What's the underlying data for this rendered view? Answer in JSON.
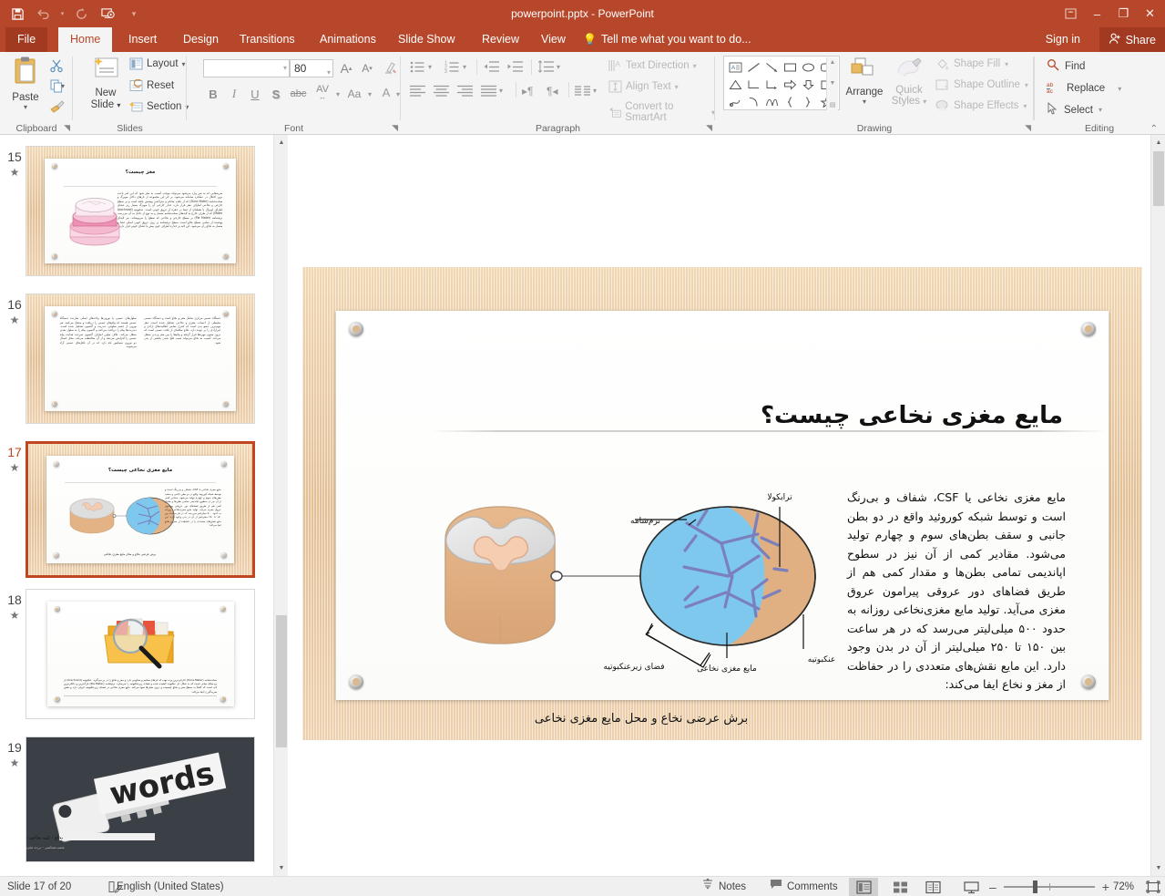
{
  "titlebar": {
    "document_title": "powerpoint.pptx - PowerPoint",
    "qat": [
      {
        "name": "save",
        "glyph": "save-icon"
      },
      {
        "name": "undo",
        "glyph": "undo-icon"
      },
      {
        "name": "redo",
        "glyph": "redo-icon"
      },
      {
        "name": "start-from-beginning",
        "glyph": "slideshow-icon"
      },
      {
        "name": "customize-qat",
        "glyph": "chevron-down-icon"
      }
    ],
    "window_controls": {
      "ribbon_display_options": "ribbon-options-icon",
      "minimize": "–",
      "restore": "❐",
      "close": "✕"
    }
  },
  "tabs": {
    "file": "File",
    "items": [
      "Home",
      "Insert",
      "Design",
      "Transitions",
      "Animations",
      "Slide Show",
      "Review",
      "View"
    ],
    "active": "Home",
    "tell_me": "Tell me what you want to do...",
    "sign_in": "Sign in",
    "share": "Share"
  },
  "ribbon": {
    "groups": [
      {
        "name": "Clipboard",
        "label": "Clipboard"
      },
      {
        "name": "Slides",
        "label": "Slides"
      },
      {
        "name": "Font",
        "label": "Font"
      },
      {
        "name": "Paragraph",
        "label": "Paragraph"
      },
      {
        "name": "Drawing",
        "label": "Drawing"
      },
      {
        "name": "Editing",
        "label": "Editing"
      }
    ],
    "clipboard": {
      "paste": "Paste",
      "cut": "cut-icon",
      "copy": "copy-icon",
      "format_painter": "format-painter-icon"
    },
    "slides": {
      "new_slide_line1": "New",
      "new_slide_line2": "Slide",
      "layout": "Layout",
      "reset": "Reset",
      "section": "Section"
    },
    "font": {
      "font_name": "",
      "font_name_placeholder": "",
      "font_size": "80",
      "grow_font": "A",
      "shrink_font": "A",
      "clear_formatting": "clear-formatting-icon",
      "bold": "B",
      "italic": "I",
      "underline": "U",
      "shadow": "S",
      "strikethrough": "abc",
      "character_spacing": "AV",
      "change_case": "Aa",
      "font_color": "A"
    },
    "paragraph": {
      "text_direction": "Text Direction",
      "align_text": "Align Text",
      "convert_to_smartart": "Convert to SmartArt"
    },
    "drawing": {
      "arrange": "Arrange",
      "quick_styles_line1": "Quick",
      "quick_styles_line2": "Styles",
      "shape_fill": "Shape Fill",
      "shape_outline": "Shape Outline",
      "shape_effects": "Shape Effects"
    },
    "editing": {
      "find": "Find",
      "replace": "Replace",
      "select": "Select"
    }
  },
  "thumbnails": [
    {
      "number": "15",
      "title": "مغز چیست؟",
      "kind": "brain-layers",
      "selected": false
    },
    {
      "number": "16",
      "title": "",
      "kind": "text-two-column",
      "selected": false
    },
    {
      "number": "17",
      "title": "مایع مغزی نخاعی چیست؟",
      "kind": "csf-diagram",
      "selected": true
    },
    {
      "number": "18",
      "title": "",
      "kind": "folder-magnifier",
      "selected": false
    },
    {
      "number": "19",
      "title": "words",
      "kind": "photo-keys-words",
      "selected": false
    }
  ],
  "slide": {
    "title": "مایع مغزی نخاعی چیست؟",
    "body": "مایع مغزی نخاعی یا CSF، شفاف و بی‌رنگ است و توسط شبکه کوروئید واقع در دو بطن جانبی و سقف بطن‌های سوم و چهارم تولید می‌شود. مقادیر کمی از آن نیز در سطوح اپاندیمی تمامی بطن‌ها و مقدار کمی هم از طریق فضاهای دور عروقی پیرامون عروق مغزی می‌آید. تولید مایع مغزی‌نخاعی روزانه به حدود ۵۰۰ میلی‌لیتر می‌رسد که در هر ساعت بین ۱۵۰ تا ۲۵۰ میلی‌لیتر از آن در بدن وجود دارد. این مایع نقش‌های متعددی را در حفاظت از مغز و نخاع ایفا می‌کند:",
    "figure_caption": "برش عرضی نخاع و محل مایع مغزی نخاعی",
    "diagram_labels": [
      {
        "id": "trabecula",
        "text": "ترابکولا"
      },
      {
        "id": "pia-mater",
        "text": "نرم‌شامه"
      },
      {
        "id": "arachnoid",
        "text": "عنکبوتیه"
      },
      {
        "id": "csf",
        "text": "مایع مغزی نخاعی"
      },
      {
        "id": "subarachnoid-space",
        "text": "فضای زیرعنکبوتیه"
      }
    ]
  },
  "statusbar": {
    "slide_counter": "Slide 17 of 20",
    "spell_icon": "spellcheck-icon",
    "language": "English (United States)",
    "notes": "Notes",
    "comments": "Comments",
    "views": [
      {
        "name": "normal",
        "icon": "normal-view-icon",
        "active": true
      },
      {
        "name": "slide-sorter",
        "icon": "slide-sorter-icon",
        "active": false
      },
      {
        "name": "reading",
        "icon": "reading-view-icon",
        "active": false
      },
      {
        "name": "slide-show",
        "icon": "slide-show-icon",
        "active": false
      }
    ],
    "zoom_out": "–",
    "zoom_in": "+",
    "zoom_level": "72%",
    "fit_to_window": "fit-slide-icon"
  },
  "colors": {
    "brand": "#b7472a",
    "brand_dark": "#a23921",
    "ribbon_bg": "#f4f4f4",
    "selection": "#c0461f",
    "csf_blue": "#7ec8ee",
    "trabecula_purple": "#7b7fbc",
    "tissue_tan": "#e3b285",
    "wood": "#e8c89f"
  }
}
